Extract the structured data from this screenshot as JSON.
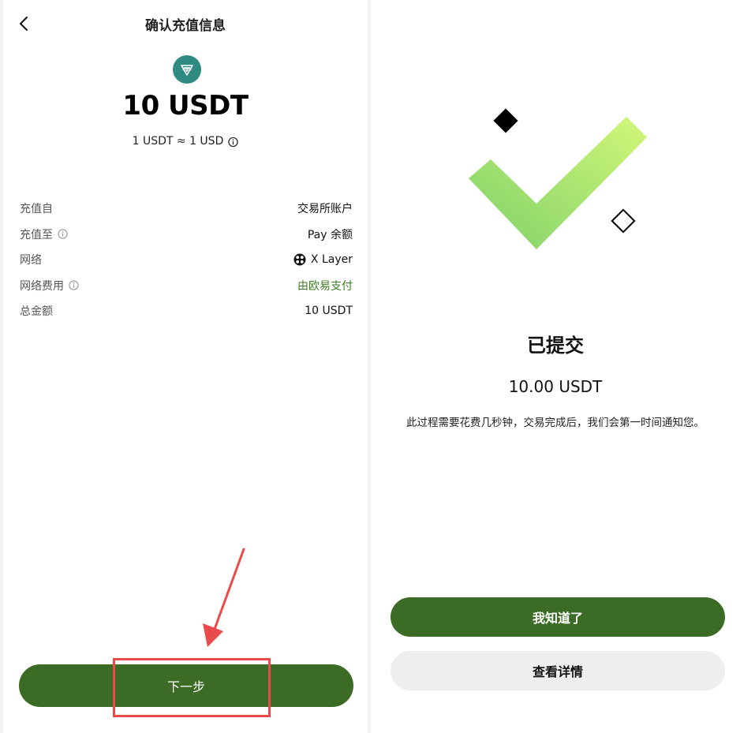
{
  "left": {
    "header": {
      "title": "确认充值信息"
    },
    "token": {
      "amount": "10 USDT",
      "rate": "1 USDT ≈ 1 USD"
    },
    "details": [
      {
        "label": "充值自",
        "value": "交易所账户",
        "info": false,
        "value_icon": ""
      },
      {
        "label": "充值至",
        "value": "Pay 余额",
        "info": true,
        "value_icon": ""
      },
      {
        "label": "网络",
        "value": "X Layer",
        "info": false,
        "value_icon": "x-layer-icon"
      },
      {
        "label": "网络费用",
        "value": "由欧易支付",
        "info": true,
        "value_icon": "",
        "value_color": "#3e7d26"
      },
      {
        "label": "总金额",
        "value": "10 USDT",
        "info": false,
        "value_icon": ""
      }
    ],
    "next_button": "下一步"
  },
  "right": {
    "title": "已提交",
    "amount": "10.00 USDT",
    "description": "此过程需要花费几秒钟，交易完成后，我们会第一时间通知您。",
    "primary_button": "我知道了",
    "secondary_button": "查看详情"
  },
  "colors": {
    "brand_green": "#3b6b24",
    "fee_green": "#3e7d26",
    "usdt_teal": "#2f8a82",
    "annotation_red": "#e94b4b"
  }
}
